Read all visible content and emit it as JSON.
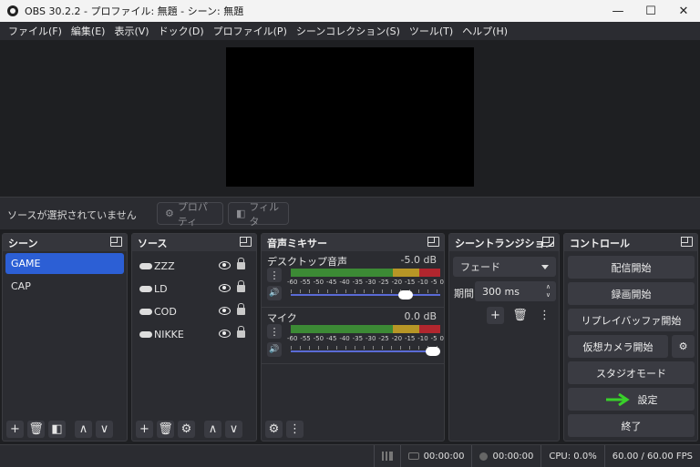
{
  "window": {
    "title": "OBS 30.2.2 - プロファイル: 無題 - シーン: 無題",
    "minimize": "—",
    "maximize": "☐",
    "close": "✕"
  },
  "menu": [
    "ファイル(F)",
    "編集(E)",
    "表示(V)",
    "ドック(D)",
    "プロファイル(P)",
    "シーンコレクション(S)",
    "ツール(T)",
    "ヘルプ(H)"
  ],
  "sourcebar": {
    "no_source": "ソースが選択されていません",
    "properties": "プロパティ",
    "filters": "フィルタ"
  },
  "scenes": {
    "title": "シーン",
    "items": [
      "GAME",
      "CAP"
    ],
    "active_index": 0
  },
  "sources": {
    "title": "ソース",
    "items": [
      "ZZZ",
      "LD",
      "COD",
      "NIKKE"
    ]
  },
  "mixer": {
    "title": "音声ミキサー",
    "channels": [
      {
        "name": "デスクトップ音声",
        "db": "-5.0 dB",
        "level": 0.82
      },
      {
        "name": "マイク",
        "db": "0.0 dB",
        "level": 1.0
      }
    ],
    "scale": [
      "-60",
      "-55",
      "-50",
      "-45",
      "-40",
      "-35",
      "-30",
      "-25",
      "-20",
      "-15",
      "-10",
      "-5",
      "0"
    ]
  },
  "transitions": {
    "title": "シーントランジション",
    "selected": "フェード",
    "duration_label": "期間",
    "duration": "300 ms"
  },
  "controls": {
    "title": "コントロール",
    "buttons": [
      "配信開始",
      "録画開始",
      "リプレイバッファ開始",
      "仮想カメラ開始",
      "スタジオモード",
      "設定",
      "終了"
    ]
  },
  "status": {
    "stream_time": "00:00:00",
    "rec_time": "00:00:00",
    "cpu": "CPU: 0.0%",
    "fps": "60.00 / 60.00 FPS"
  },
  "colors": {
    "accent": "#2c5fd5",
    "arrow": "#39d12a"
  }
}
